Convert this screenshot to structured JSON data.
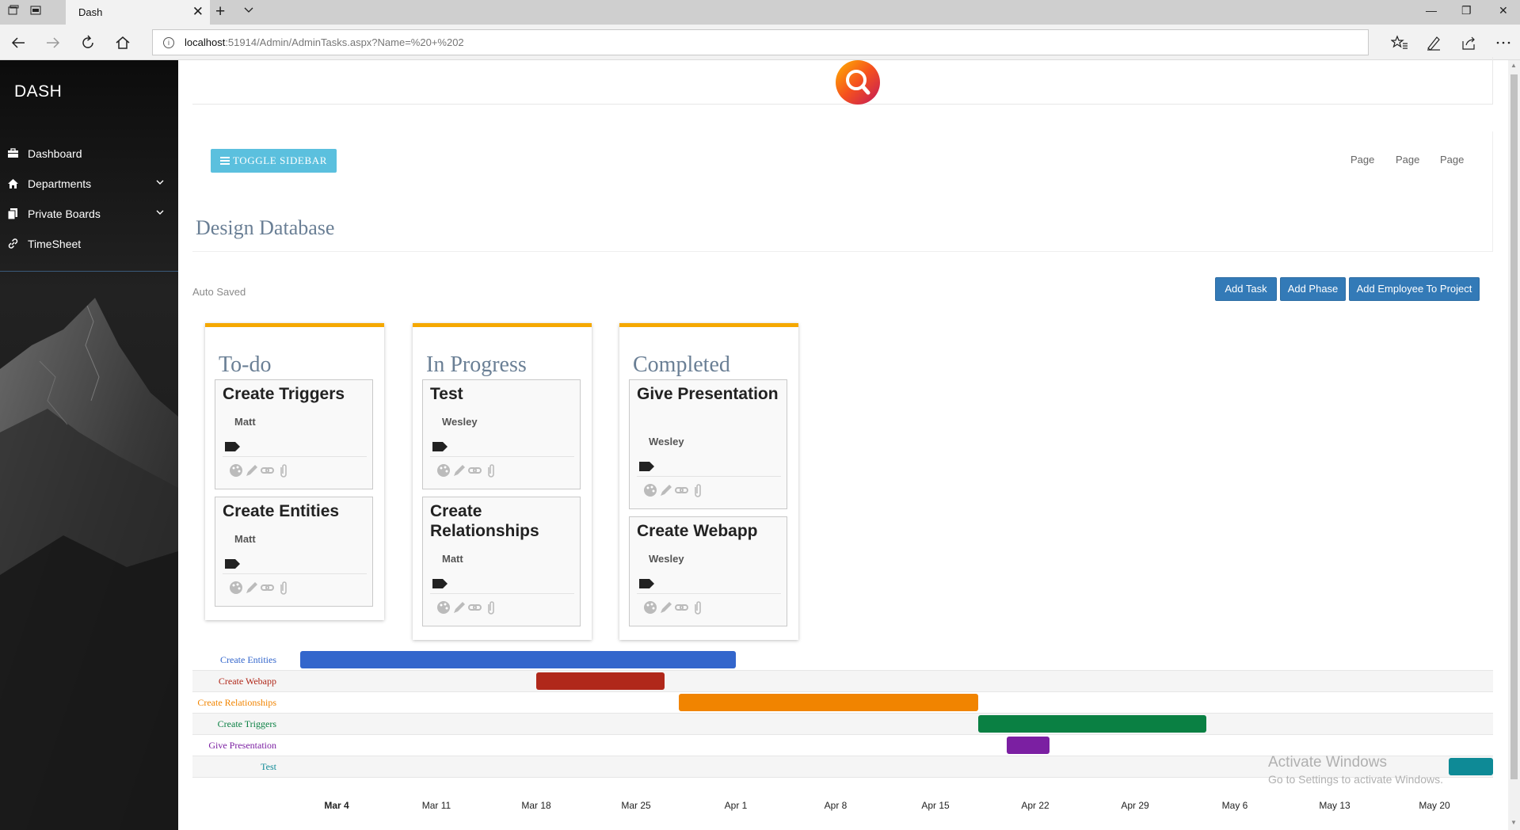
{
  "browser": {
    "tab_title": "Dash",
    "url_host": "localhost",
    "url_rest": ":51914/Admin/AdminTasks.aspx?Name=%20+%202",
    "icons": [
      "back-icon",
      "forward-icon",
      "refresh-icon",
      "home-icon",
      "favorites-icon",
      "notes-icon",
      "share-icon",
      "more-icon"
    ]
  },
  "sidebar": {
    "brand": "DASH",
    "items": [
      {
        "label": "Dashboard",
        "icon": "briefcase-icon",
        "has_chevron": false
      },
      {
        "label": "Departments",
        "icon": "home-icon",
        "has_chevron": true
      },
      {
        "label": "Private Boards",
        "icon": "documents-icon",
        "has_chevron": true
      },
      {
        "label": "TimeSheet",
        "icon": "link-icon",
        "has_chevron": false
      }
    ]
  },
  "header": {
    "toggle_label": "TOGGLE SIDEBAR",
    "page_links": [
      "Page",
      "Page",
      "Page"
    ]
  },
  "page": {
    "title": "Design Database",
    "auto_saved": "Auto Saved",
    "buttons": {
      "add_task": "Add Task",
      "add_phase": "Add Phase",
      "add_employee": "Add Employee To Project"
    }
  },
  "board": {
    "accent_color": "#f5a800",
    "columns": [
      {
        "title": "To-do",
        "tasks": [
          {
            "title": "Create Triggers",
            "assignee": "Matt"
          },
          {
            "title": "Create Entities",
            "assignee": "Matt"
          }
        ]
      },
      {
        "title": "In Progress",
        "tasks": [
          {
            "title": "Test",
            "assignee": "Wesley"
          },
          {
            "title": "Create Relationships",
            "assignee": "Matt"
          }
        ]
      },
      {
        "title": "Completed",
        "tasks": [
          {
            "title": "Give Presentation",
            "assignee": "Wesley"
          },
          {
            "title": "Create Webapp",
            "assignee": "Wesley"
          }
        ]
      }
    ]
  },
  "gantt": {
    "rows": [
      {
        "label": "Create Entities",
        "color": "#3366cc",
        "start": "2019-03-01",
        "end": "2019-04-01"
      },
      {
        "label": "Create Webapp",
        "color": "#b0281a",
        "start": "2019-03-18",
        "end": "2019-03-27"
      },
      {
        "label": "Create Relationships",
        "color": "#f18400",
        "start": "2019-03-28",
        "end": "2019-04-18"
      },
      {
        "label": "Create Triggers",
        "color": "#0a8043",
        "start": "2019-04-18",
        "end": "2019-05-04"
      },
      {
        "label": "Give Presentation",
        "color": "#7b1fa2",
        "start": "2019-04-20",
        "end": "2019-04-23"
      },
      {
        "label": "Test",
        "color": "#0e8a96",
        "start": "2019-05-21",
        "end": "2019-05-28"
      }
    ],
    "ticks": [
      "Mar 4",
      "Mar 11",
      "Mar 18",
      "Mar 25",
      "Apr 1",
      "Apr 8",
      "Apr 15",
      "Apr 22",
      "Apr 29",
      "May 6",
      "May 13",
      "May 20"
    ]
  },
  "watermark": {
    "line1": "Activate Windows",
    "line2": "Go to Settings to activate Windows."
  }
}
